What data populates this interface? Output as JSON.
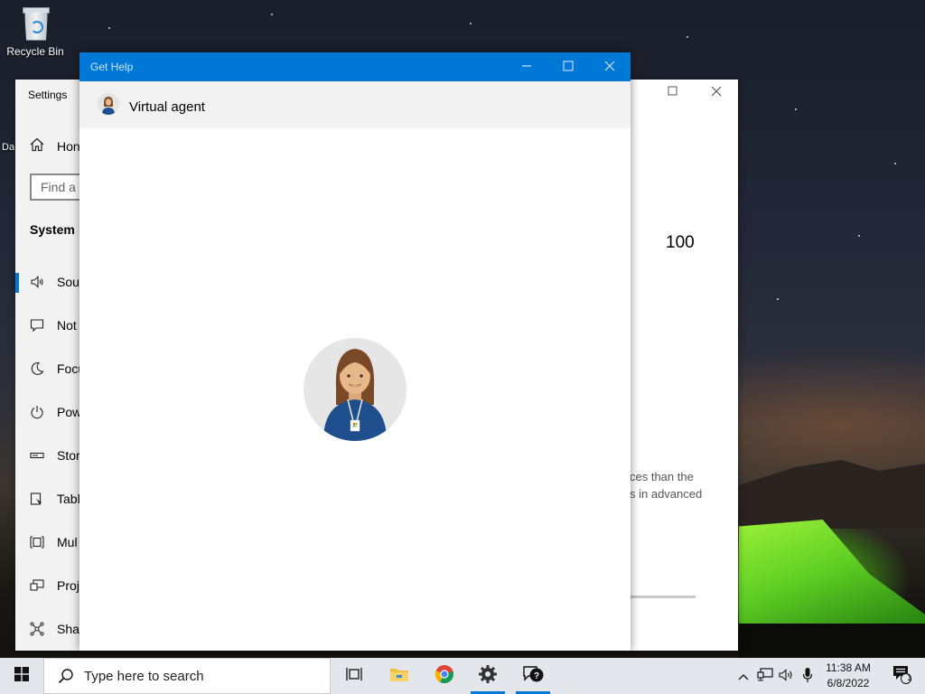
{
  "desktop": {
    "icons": [
      {
        "label": "Recycle Bin"
      }
    ],
    "partial_icon_label": "Da"
  },
  "settings_window": {
    "title": "Settings",
    "home_label": "Hon",
    "search_placeholder": "Find a s",
    "section_label": "System",
    "items": [
      {
        "label": "Sou",
        "icon": "speaker-icon"
      },
      {
        "label": "Not",
        "icon": "notification-icon"
      },
      {
        "label": "Focu",
        "icon": "moon-icon"
      },
      {
        "label": "Pow",
        "icon": "power-icon"
      },
      {
        "label": "Stor",
        "icon": "storage-icon"
      },
      {
        "label": "Tabl",
        "icon": "tablet-icon"
      },
      {
        "label": "Mul",
        "icon": "multitasking-icon"
      },
      {
        "label": "Proj",
        "icon": "projecting-icon"
      },
      {
        "label": "Sha",
        "icon": "share-icon"
      }
    ],
    "value": "100",
    "text_line1": "ces than the",
    "text_line2": "s in advanced"
  },
  "gethelp_window": {
    "title": "Get Help",
    "header_title": "Virtual agent",
    "accent_color": "#0078d7"
  },
  "taskbar": {
    "search_placeholder": "Type here to search",
    "apps": [
      "task-view-icon",
      "file-explorer-icon",
      "chrome-icon",
      "settings-icon",
      "get-help-icon"
    ],
    "time": "11:38 AM",
    "date": "6/8/2022",
    "notification_count": "1"
  }
}
